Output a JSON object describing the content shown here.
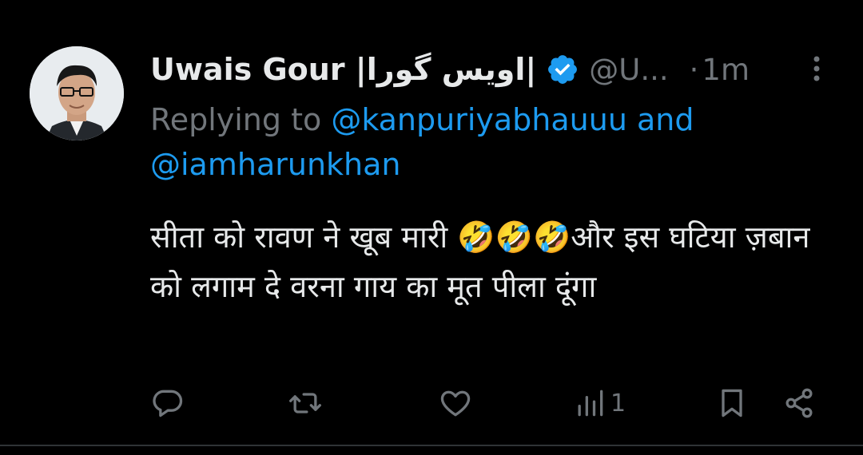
{
  "colors": {
    "background": "#000000",
    "text_primary": "#e7e9ea",
    "text_secondary": "#71767b",
    "accent_blue": "#1d9bf0",
    "verified_badge": "#1d9bf0"
  },
  "tweet": {
    "author_name": "Uwais Gour |اویس گورا|",
    "verified_icon": "verified-badge-icon",
    "handle": "@U...",
    "separator": "·",
    "time": "1m",
    "reply_prefix": "Replying to ",
    "reply_mention_1": "@kanpuriyabhauuu",
    "reply_and": " and",
    "reply_mention_2": "@iamharunkhan",
    "text": "सीता को रावण ने खूब मारी 🤣🤣🤣और इस घटिया ज़बान को लगाम दे वरना गाय का मूत पीला दूंगा"
  },
  "actions": {
    "reply_icon": "reply-icon",
    "retweet_icon": "retweet-icon",
    "like_icon": "heart-icon",
    "views_icon": "views-icon",
    "views_count": "1",
    "bookmark_icon": "bookmark-icon",
    "share_icon": "share-icon"
  }
}
